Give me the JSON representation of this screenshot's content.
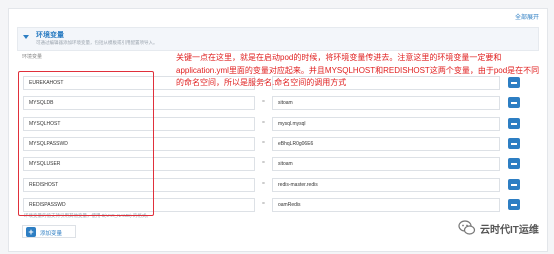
{
  "header": {
    "expand_all": "全部展开"
  },
  "section": {
    "title": "环境变量",
    "subtitle": "可通过编辑器添加环境变量，包括从模板或引用配置项导入。"
  },
  "env_label": "环境变量",
  "env_vars": [
    {
      "key": "EUREKAHOST",
      "value": ""
    },
    {
      "key": "MYSQLDB",
      "value": "sitoam"
    },
    {
      "key": "MYSQLHOST",
      "value": "mysql.mysql"
    },
    {
      "key": "MYSQLPASSWD",
      "value": "eBhqLR0g06E6"
    },
    {
      "key": "MYSQLUSER",
      "value": "sitoam"
    },
    {
      "key": "REDISHOST",
      "value": "redis-master.redis"
    },
    {
      "key": "REDISPASSWD",
      "value": "oamRedis"
    }
  ],
  "hint": "环境变量的值支持引用其他变量，使用 $(VAR_NAME) 的格式。",
  "add_button": "添加变量",
  "annotation": "关键一点在这里，就是在启动pod的时候，将环境变量传进去。注意这里的环境变量一定要和application.yml里面的变量对应起来。并且MYSQLHOST和REDISHOST这两个变量，由于pod是在不同的命名空间，所以是服务名.命名空间的调用方式",
  "watermark": "云时代IT运维",
  "colors": {
    "accent": "#2d7ec3",
    "annotation": "#e02020",
    "highlight_border": "#e0303b"
  }
}
